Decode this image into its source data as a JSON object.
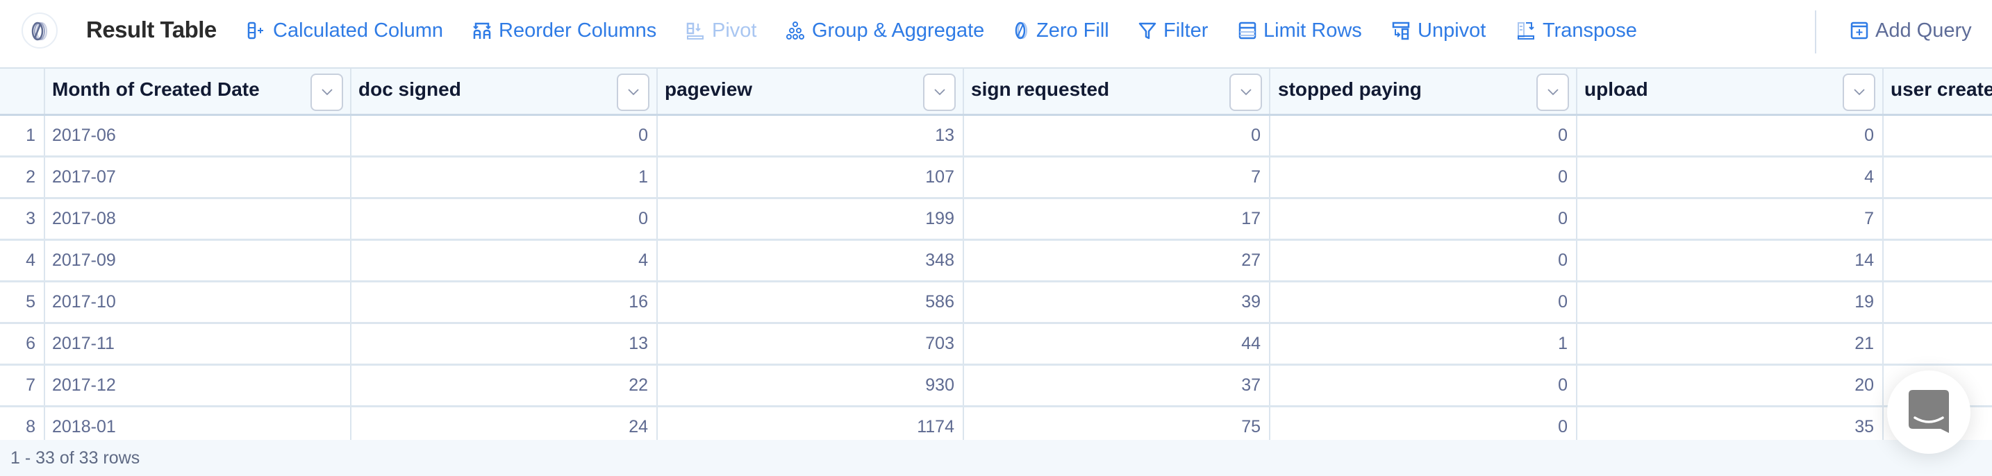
{
  "toolbar": {
    "title": "Result Table",
    "items": [
      {
        "label": "Calculated Column",
        "icon": "calculated-column-icon",
        "enabled": true
      },
      {
        "label": "Reorder Columns",
        "icon": "reorder-columns-icon",
        "enabled": true
      },
      {
        "label": "Pivot",
        "icon": "pivot-icon",
        "enabled": false
      },
      {
        "label": "Group & Aggregate",
        "icon": "group-aggregate-icon",
        "enabled": true
      },
      {
        "label": "Zero Fill",
        "icon": "zero-fill-icon",
        "enabled": true
      },
      {
        "label": "Filter",
        "icon": "filter-icon",
        "enabled": true
      },
      {
        "label": "Limit Rows",
        "icon": "limit-rows-icon",
        "enabled": true
      },
      {
        "label": "Unpivot",
        "icon": "unpivot-icon",
        "enabled": true
      },
      {
        "label": "Transpose",
        "icon": "transpose-icon",
        "enabled": true
      }
    ],
    "add_query": "Add Query"
  },
  "table": {
    "columns": [
      "Month of Created Date",
      "doc signed",
      "pageview",
      "sign requested",
      "stopped paying",
      "upload",
      "user created"
    ],
    "rows": [
      {
        "n": "1",
        "cells": [
          "2017-06",
          "0",
          "13",
          "0",
          "0",
          "0"
        ]
      },
      {
        "n": "2",
        "cells": [
          "2017-07",
          "1",
          "107",
          "7",
          "0",
          "4"
        ]
      },
      {
        "n": "3",
        "cells": [
          "2017-08",
          "0",
          "199",
          "17",
          "0",
          "7"
        ]
      },
      {
        "n": "4",
        "cells": [
          "2017-09",
          "4",
          "348",
          "27",
          "0",
          "14"
        ]
      },
      {
        "n": "5",
        "cells": [
          "2017-10",
          "16",
          "586",
          "39",
          "0",
          "19"
        ]
      },
      {
        "n": "6",
        "cells": [
          "2017-11",
          "13",
          "703",
          "44",
          "1",
          "21"
        ]
      },
      {
        "n": "7",
        "cells": [
          "2017-12",
          "22",
          "930",
          "37",
          "0",
          "20"
        ]
      },
      {
        "n": "8",
        "cells": [
          "2018-01",
          "24",
          "1174",
          "75",
          "0",
          "35"
        ]
      }
    ]
  },
  "footer": {
    "row_count": "1 - 33 of 33 rows"
  },
  "colors": {
    "accent": "#2f7be5",
    "disabled": "#a9c6f1",
    "header_bg": "#f3f9fd",
    "cell_text": "#5e6a91"
  }
}
